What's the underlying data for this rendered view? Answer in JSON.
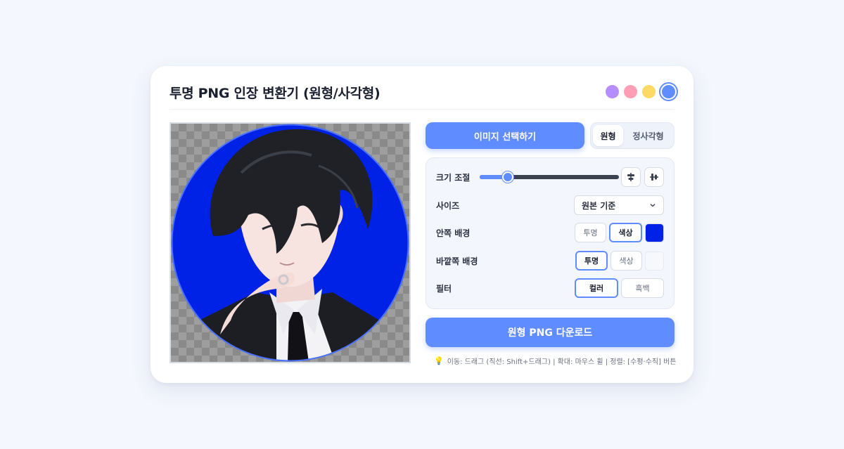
{
  "app": {
    "title": "투명 PNG 인장 변환기 (원형/사각형)"
  },
  "theme_colors": [
    "#b68cff",
    "#ff9eb5",
    "#ffd966",
    "#5f8cff"
  ],
  "preview": {
    "background_color": "#0022e6"
  },
  "controls": {
    "select_image_label": "이미지 선택하기",
    "shape_tabs": [
      {
        "label": "원형",
        "active": true
      },
      {
        "label": "정사각형",
        "active": false
      }
    ],
    "size_adjust": {
      "label": "크기 조절",
      "value": 0.2,
      "align_icons": [
        "align-horizontal-center-icon",
        "align-vertical-center-icon"
      ]
    },
    "size_preset": {
      "label": "사이즈",
      "selected": "원본 기준"
    },
    "inner_bg": {
      "label": "안쪽 배경",
      "options": [
        "투명",
        "색상"
      ],
      "active": "색상",
      "color": "#0022e6"
    },
    "outer_bg": {
      "label": "바깥쪽 배경",
      "options": [
        "투명",
        "색상"
      ],
      "active": "투명",
      "color": "#f6f8fc"
    },
    "filter": {
      "label": "필터",
      "options": [
        "컬러",
        "흑백"
      ],
      "active": "컬러"
    },
    "download_label": "원형 PNG 다운로드",
    "hint": "이동: 드래그 (직선: Shift+드래그) | 확대: 마우스 휠 | 정렬: [수평·수직] 버튼"
  }
}
